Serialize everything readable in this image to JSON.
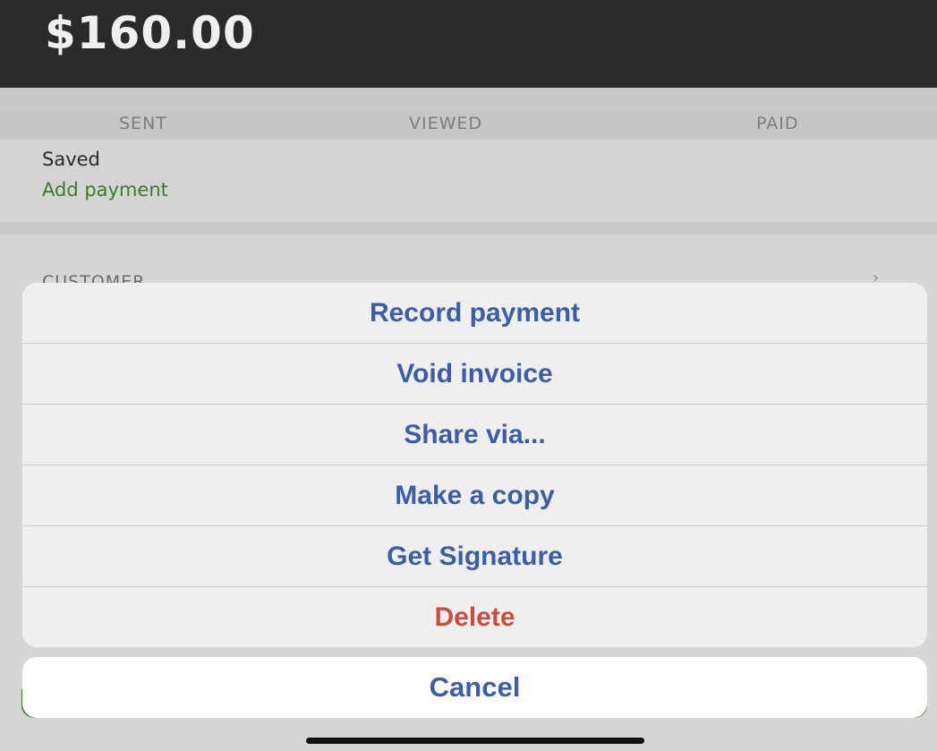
{
  "invoice": {
    "amount": "$160.00",
    "status_steps": [
      "SENT",
      "VIEWED",
      "PAID"
    ],
    "state": "Saved",
    "add_payment_link": "Add payment",
    "customer_section_label": "CUSTOMER"
  },
  "action_sheet": {
    "items": [
      {
        "label": "Record payment"
      },
      {
        "label": "Void invoice"
      },
      {
        "label": "Share via..."
      },
      {
        "label": "Make a copy"
      },
      {
        "label": "Get Signature"
      },
      {
        "label": "Delete",
        "style": "destructive"
      }
    ],
    "cancel_label": "Cancel"
  },
  "colors": {
    "action": "#3b5ea8",
    "destructive": "#d24a3c",
    "link_green": "#3f7a2c",
    "header_bg": "#2a2a2a"
  }
}
